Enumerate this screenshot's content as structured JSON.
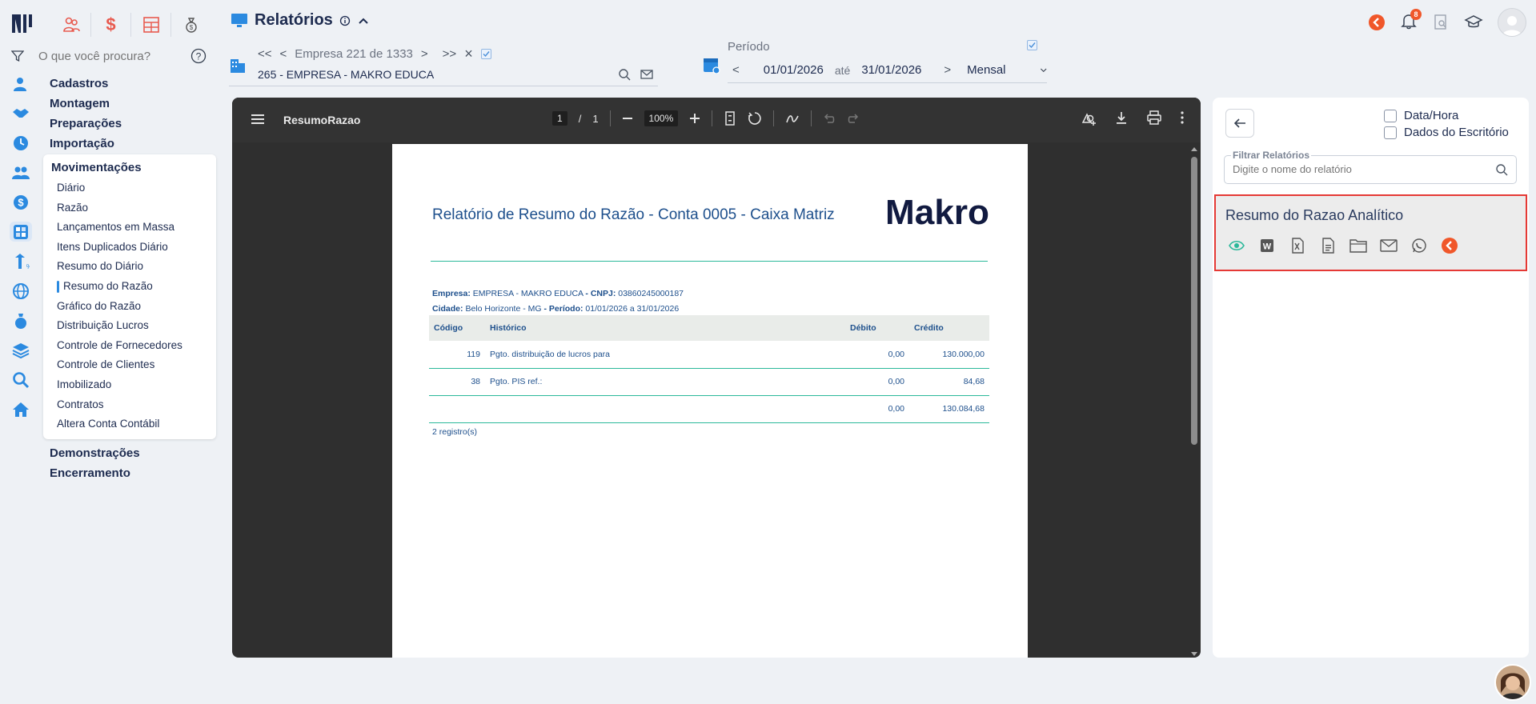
{
  "header": {
    "title": "Relatórios",
    "notification_count": "8"
  },
  "search": {
    "placeholder": "O que você procura?"
  },
  "menu": {
    "groups_before": [
      "Cadastros",
      "Montagem",
      "Preparações",
      "Importação"
    ],
    "active_group": "Movimentações",
    "items": [
      "Diário",
      "Razão",
      "Lançamentos em Massa",
      "Itens Duplicados Diário",
      "Resumo do Diário",
      "Resumo do Razão",
      "Gráfico do Razão",
      "Distribuição Lucros",
      "Controle de Fornecedores",
      "Controle de Clientes",
      "Imobilizado",
      "Contratos",
      "Altera Conta Contábil"
    ],
    "active_item": "Resumo do Razão",
    "groups_after": [
      "Demonstrações",
      "Encerramento"
    ]
  },
  "company": {
    "nav_first": "<<",
    "nav_prev": "<",
    "counter": "Empresa  221 de 1333",
    "nav_next": ">",
    "nav_last": ">>",
    "clear": "×",
    "selected": "265 - EMPRESA - MAKRO EDUCA"
  },
  "period": {
    "label": "Período",
    "prev": "<",
    "start": "01/01/2026",
    "separator": "até",
    "end": "31/01/2026",
    "next": ">",
    "frequency": "Mensal"
  },
  "viewer": {
    "file_name": "ResumoRazao",
    "page_current": "1",
    "page_sep": "/",
    "page_total": "1",
    "zoom": "100%"
  },
  "report": {
    "title": "Relatório de Resumo do Razão - Conta 0005 - Caixa Matriz",
    "logo_text": "Makro",
    "empresa_label": "Empresa:",
    "empresa": "EMPRESA - MAKRO EDUCA",
    "cnpj_label": "- CNPJ:",
    "cnpj": "03860245000187",
    "cidade_label": "Cidade:",
    "cidade": "Belo Horizonte",
    "uf_sep": "- MG",
    "periodo_label": "- Período:",
    "periodo": "01/01/2026 a 31/01/2026",
    "columns": [
      "Código",
      "Histórico",
      "Débito",
      "Crédito"
    ],
    "rows": [
      {
        "codigo": "119",
        "historico": "Pgto. distribuição de lucros para",
        "debito": "0,00",
        "credito": "130.000,00"
      },
      {
        "codigo": "38",
        "historico": "Pgto. PIS ref.:",
        "debito": "0,00",
        "credito": "84,68"
      }
    ],
    "total": {
      "debito": "0,00",
      "credito": "130.084,68"
    },
    "count": "2 registro(s)"
  },
  "panel": {
    "option_datetime": "Data/Hora",
    "option_office": "Dados do Escritório",
    "filter_label": "Filtrar Relatórios",
    "filter_placeholder": "Digite o nome do relatório",
    "card_title": "Resumo do Razao Analítico"
  },
  "colors": {
    "accent": "#1d4f8c",
    "brand_orange": "#f0572a",
    "highlight_border": "#e53935",
    "teal_rule": "#2bb89a"
  }
}
